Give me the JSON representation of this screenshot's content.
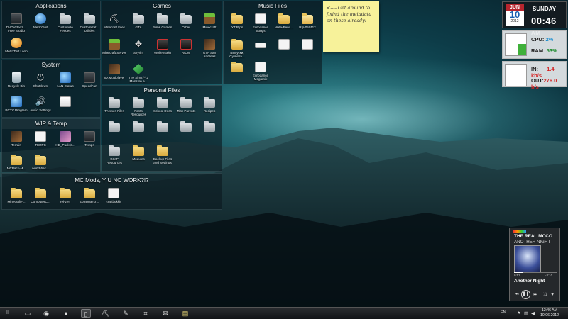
{
  "fences": {
    "applications": {
      "title": "Applications",
      "items": [
        {
          "label": "DVDVideoS... Free Studio",
          "icon": "dvd-icon"
        },
        {
          "label": "MetroTwit",
          "icon": "metrotwit-icon"
        },
        {
          "label": "Customize Fences",
          "icon": "folder-icon"
        },
        {
          "label": "Customizat... Utilities",
          "icon": "folder-icon"
        },
        {
          "label": "MetroTwit Loop",
          "icon": "metrotwit-icon"
        }
      ]
    },
    "games": {
      "title": "Games",
      "items": [
        {
          "label": "Minecraft Files",
          "icon": "pickaxe-icon"
        },
        {
          "label": "GTA",
          "icon": "folder-icon"
        },
        {
          "label": "Sims Games",
          "icon": "folder-icon"
        },
        {
          "label": "Other",
          "icon": "folder-icon"
        },
        {
          "label": "Minecraft",
          "icon": "minecraft-icon"
        },
        {
          "label": "Minecraft Server",
          "icon": "minecraft-icon"
        },
        {
          "label": "Skyrim",
          "icon": "skyrim-icon"
        },
        {
          "label": "Wolfenstein",
          "icon": "game-icon"
        },
        {
          "label": "RtCW",
          "icon": "game-icon"
        },
        {
          "label": "GTA San Andreas",
          "icon": "game-icon"
        },
        {
          "label": "SA Multiplayer",
          "icon": "game-icon"
        },
        {
          "label": "The Sims™ 2 Mansion a...",
          "icon": "sims-icon"
        }
      ]
    },
    "music": {
      "title": "Music Files",
      "items": [
        {
          "label": "YT Rips",
          "icon": "folder-icon"
        },
        {
          "label": "Eurodance Songs",
          "icon": "music-file-icon"
        },
        {
          "label": "Meta-Pend...",
          "icon": "folder-icon"
        },
        {
          "label": "Rip-050112",
          "icon": "archive-icon"
        },
        {
          "label": "Выпуски, Сухбота...",
          "icon": "folder-icon"
        },
        {
          "label": "",
          "icon": "usb-icon"
        },
        {
          "label": "",
          "icon": "file-icon"
        },
        {
          "label": "",
          "icon": "file-icon"
        },
        {
          "label": "",
          "icon": "folder-icon"
        },
        {
          "label": "Eurodance Megamix",
          "icon": "music-file-icon"
        }
      ]
    },
    "system": {
      "title": "System",
      "items": [
        {
          "label": "Recycle Bin",
          "icon": "recycle-bin-icon"
        },
        {
          "label": "Shutdown",
          "icon": "power-icon"
        },
        {
          "label": "LAN Status",
          "icon": "network-icon"
        },
        {
          "label": "SpeedFan",
          "icon": "fan-icon"
        },
        {
          "label": "PCTV Program",
          "icon": "tv-icon"
        },
        {
          "label": "Audio Settings",
          "icon": "speaker-icon"
        },
        {
          "label": "",
          "icon": "settings-icon"
        }
      ]
    },
    "personal": {
      "title": "Personal Files",
      "items": [
        {
          "label": "Themes Files",
          "icon": "folder-icon"
        },
        {
          "label": "Fonts Resources",
          "icon": "folder-icon"
        },
        {
          "label": "School Docs",
          "icon": "folder-icon"
        },
        {
          "label": "Misc Parents",
          "icon": "folder-icon"
        },
        {
          "label": "Recipes",
          "icon": "folder-icon"
        },
        {
          "label": "",
          "icon": "folder-icon"
        },
        {
          "label": "",
          "icon": "folder-icon"
        },
        {
          "label": "",
          "icon": "folder-icon"
        },
        {
          "label": "",
          "icon": "folder-icon"
        },
        {
          "label": "",
          "icon": "folder-icon"
        },
        {
          "label": "GIMP Resources",
          "icon": "folder-icon"
        },
        {
          "label": "Modules",
          "icon": "folder-icon"
        },
        {
          "label": "Backup Files and Settings",
          "icon": "folder-icon"
        }
      ]
    },
    "wip": {
      "title": "WIP & Temp",
      "items": [
        {
          "label": "Terrain",
          "icon": "image-icon"
        },
        {
          "label": "TERPS",
          "icon": "image-icon"
        },
        {
          "label": "HD_Pack(3...",
          "icon": "archive-icon"
        },
        {
          "label": "Temps",
          "icon": "image-icon"
        },
        {
          "label": "MCPack-M...",
          "icon": "folder-icon"
        },
        {
          "label": "world-bac...",
          "icon": "folder-icon"
        }
      ]
    },
    "mods": {
      "title": "MC Mods, Y U NO WORK?!?",
      "items": [
        {
          "label": "MinecraftF...",
          "icon": "folder-icon"
        },
        {
          "label": "ComputerC...",
          "icon": "folder-icon"
        },
        {
          "label": "rei-zen",
          "icon": "folder-icon"
        },
        {
          "label": "computercr...",
          "icon": "folder-icon"
        },
        {
          "label": "craftbukkit",
          "icon": "file-icon"
        }
      ]
    }
  },
  "note": {
    "text": "<---- Get around to fixind the metadata on these already!"
  },
  "clock": {
    "month": "JUN",
    "day": "10",
    "year": "2012",
    "weekday": "SUNDAY",
    "time": "00:46",
    "ampm": "AM"
  },
  "sysmon": {
    "cpu_label": "CPU:",
    "cpu_value": "2%",
    "ram_label": "RAM:",
    "ram_value": "53%",
    "ram_fraction": 0.53
  },
  "network": {
    "in_label": "IN:",
    "in_value": "1.4 kb/s",
    "out_label": "OUT:",
    "out_value": "276.0 b/s"
  },
  "player": {
    "artist": "THE REAL MCCO",
    "album": "ANOTHER NIGHT",
    "elapsed": "0:53",
    "remaining": "-3:10",
    "track": "Another Night",
    "progress_fraction": 0.22
  },
  "taskbar": {
    "items": [
      "start-icon",
      "explorer-icon",
      "firefox-icon",
      "messenger-icon",
      "phone-icon",
      "minecraft-icon",
      "paint-icon",
      "crop-icon",
      "mail-icon",
      "notes-icon"
    ],
    "lang": "EN",
    "time": "12:46 AM",
    "date": "10.06.2012"
  },
  "colors": {
    "fence_bg": "#0c181e",
    "note_bg": "#f7f29a",
    "cal_red": "#b8262e",
    "cpu_blue": "#1e8fd0",
    "ram_green": "#1a8a2a",
    "net_red": "#d42020"
  }
}
